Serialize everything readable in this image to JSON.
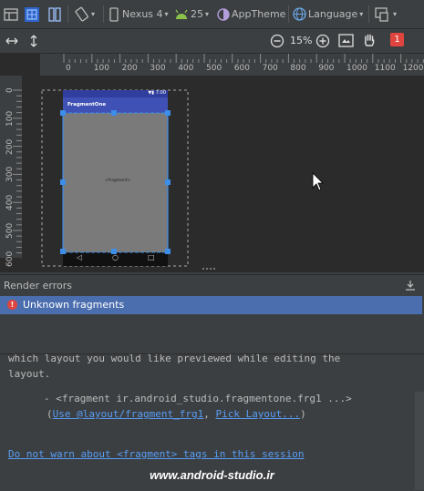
{
  "toolbar": {
    "device_label": "Nexus 4",
    "api_label": "25",
    "theme_label": "AppTheme",
    "language_label": "Language"
  },
  "zoom": {
    "level": "15%"
  },
  "error_badge": "1",
  "ruler_top": [
    "0",
    "100",
    "200",
    "300",
    "400",
    "500",
    "600",
    "700",
    "800",
    "900",
    "1000",
    "1100",
    "1200"
  ],
  "ruler_left": [
    "0",
    "100",
    "200",
    "300",
    "400",
    "500",
    "600"
  ],
  "phone": {
    "status_time": "7:00",
    "app_title": "FragmentOne",
    "fragment_label": "<fragment>"
  },
  "render_errors": {
    "title": "Render errors",
    "issue": "Unknown fragments",
    "body_line1": "which layout you would like previewed while editing the",
    "body_line2": "layout.",
    "fragment_line": "- <fragment ir.android_studio.fragmentone.frg1 ...>",
    "paren_open": "(",
    "use_link": "Use @layout/fragment_frg1",
    "comma": ", ",
    "pick_link": "Pick Layout...",
    "paren_close": ")",
    "dont_warn_link": "Do not warn about <fragment> tags in this session"
  },
  "watermark": "www.android-studio.ir",
  "colors": {
    "app_bar": "#3f51b5",
    "selection": "#4b6eaf",
    "link": "#589df6",
    "badge": "#e0443e"
  }
}
